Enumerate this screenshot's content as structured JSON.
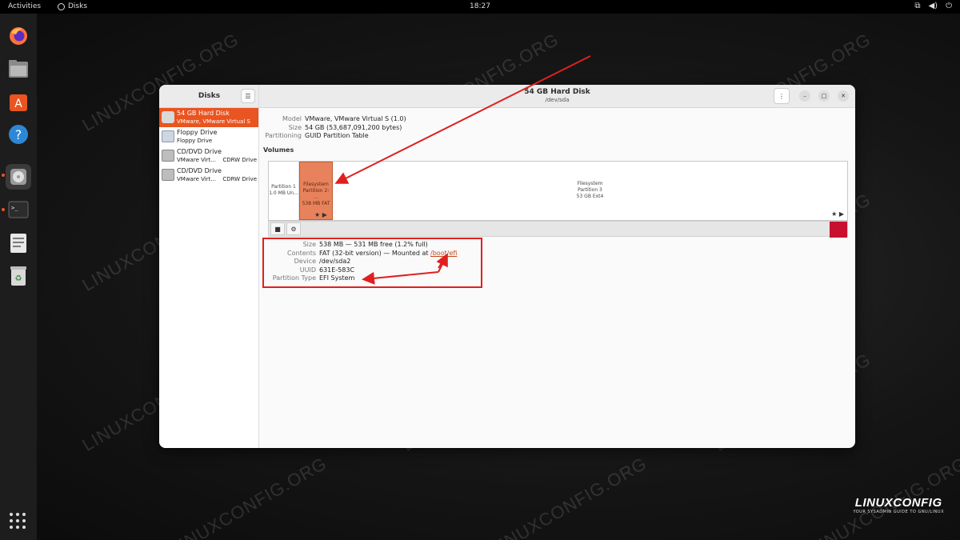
{
  "topbar": {
    "activities": "Activities",
    "app_name": "Disks",
    "clock": "18:27"
  },
  "window": {
    "sidebar_title": "Disks",
    "title": "54 GB Hard Disk",
    "subtitle": "/dev/sda"
  },
  "drives": [
    {
      "name": "54 GB Hard Disk",
      "sub": "VMware, VMware Virtual S",
      "sub2": ""
    },
    {
      "name": "Floppy Drive",
      "sub": "Floppy Drive",
      "sub2": ""
    },
    {
      "name": "CD/DVD Drive",
      "sub": "VMware Virt...",
      "sub2": "CDRW Drive"
    },
    {
      "name": "CD/DVD Drive",
      "sub": "VMware Virt...",
      "sub2": "CDRW Drive"
    }
  ],
  "disk_info": {
    "model_label": "Model",
    "model": "VMware, VMware Virtual S (1.0)",
    "size_label": "Size",
    "size": "54 GB (53,687,091,200 bytes)",
    "partitioning_label": "Partitioning",
    "partitioning": "GUID Partition Table"
  },
  "volumes_title": "Volumes",
  "volumes": [
    {
      "line1": "Partition 1",
      "line2": "1.0 MB Un..."
    },
    {
      "line1": "Filesystem",
      "line2": "Partition 2: ...",
      "line3": "538 MB FAT"
    },
    {
      "line1": "Filesystem",
      "line2": "Partition 3",
      "line3": "53 GB Ext4"
    }
  ],
  "partition_info": {
    "size_label": "Size",
    "size": "538 MB — 531 MB free (1.2% full)",
    "contents_label": "Contents",
    "contents": "FAT (32-bit version) — Mounted at ",
    "mount": "/boot/efi",
    "device_label": "Device",
    "device": "/dev/sda2",
    "uuid_label": "UUID",
    "uuid": "631E-583C",
    "ptype_label": "Partition Type",
    "ptype": "EFI System"
  },
  "watermark": "LINUXCONFIG.ORG",
  "logo": {
    "name": "LINUXCONFIG",
    "tag": "YOUR SYSADMIN GUIDE TO GNU/LINUX"
  },
  "colors": {
    "accent": "#e95420",
    "annotation": "#e02020"
  }
}
